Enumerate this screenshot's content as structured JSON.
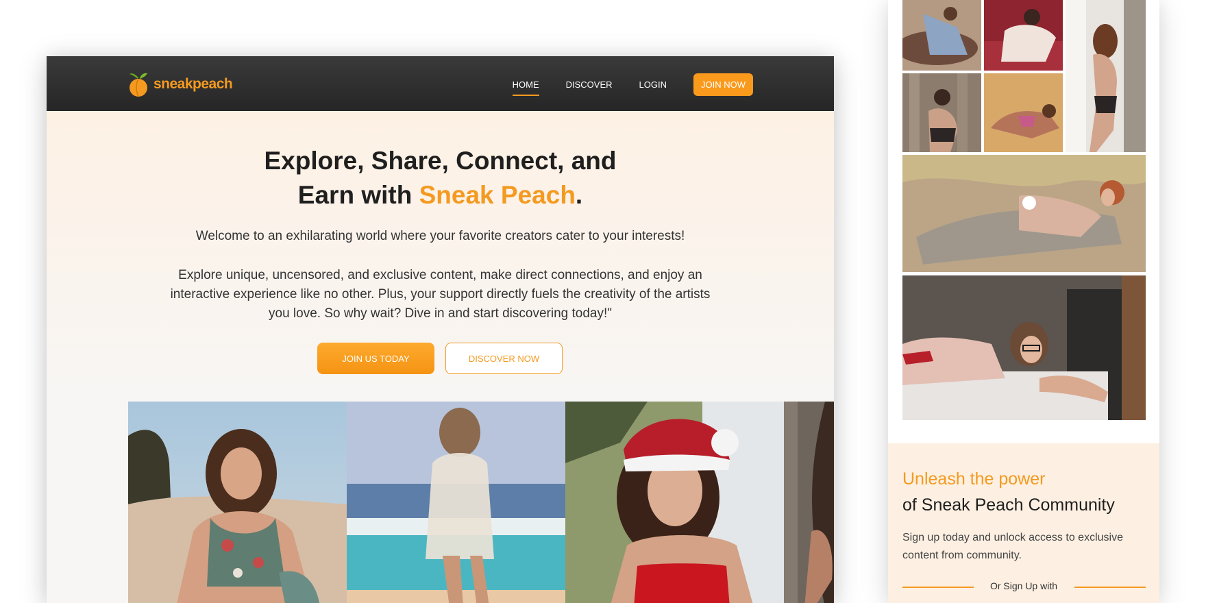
{
  "brand": {
    "name": "sneakpeach",
    "accent_color": "#f49a20",
    "dark_color": "#2b2b2b"
  },
  "nav": {
    "links": [
      {
        "label": "HOME",
        "active": true
      },
      {
        "label": "DISCOVER",
        "active": false
      },
      {
        "label": "LOGIN",
        "active": false
      }
    ],
    "cta": "JOIN NOW"
  },
  "hero": {
    "title_line1": "Explore, Share, Connect, and",
    "title_line2_prefix": "Earn with ",
    "title_accent": "Sneak Peach",
    "title_suffix": ".",
    "paragraph1": "Welcome to an exhilarating world where your favorite creators cater to your interests!",
    "paragraph2": "Explore unique, uncensored, and exclusive content, make direct connections, and enjoy an interactive experience like no other. Plus, your support directly fuels the creativity of the artists you love. So why wait? Dive in and start discovering today!\"",
    "primary_button": "JOIN US TODAY",
    "secondary_button": "DISCOVER NOW"
  },
  "mobile_signup": {
    "heading_accent": "Unleash the power",
    "heading": "of Sneak Peach Community",
    "body": "Sign up today and unlock access to exclusive content from community.",
    "divider_text": "Or Sign Up with"
  }
}
